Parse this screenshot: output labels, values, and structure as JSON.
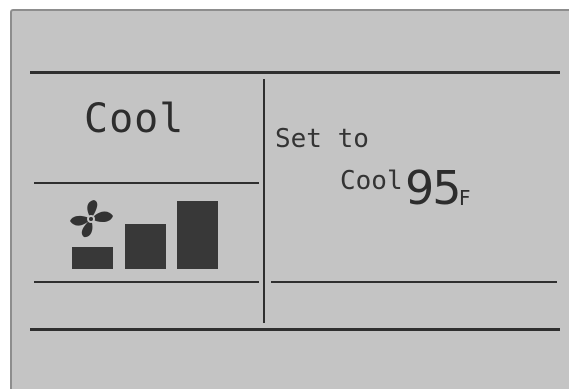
{
  "display": {
    "mode_label": "Cool",
    "set_to_label": "Set to",
    "set_mode_label": "Cool",
    "set_temperature": "95",
    "temperature_unit": "F"
  },
  "fan": {
    "icon": "fan-icon",
    "speed_level": 3,
    "speed_levels_total": 3
  },
  "colors": {
    "lcd_background": "#c4c4c4",
    "segment": "#2f2f2f"
  }
}
